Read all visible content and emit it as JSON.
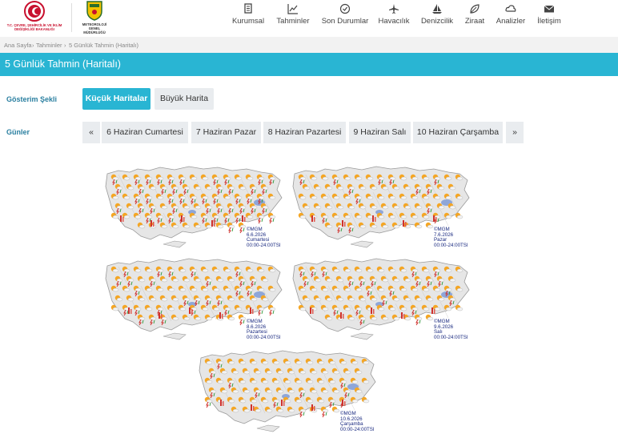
{
  "header": {
    "logo1_text": "T.C. ÇEVRE, ŞEHİRCİLİK VE İKLİM DEĞİŞİKLİĞİ BAKANLIĞI",
    "logo2_text": "METEOROLOJİ GENEL MÜDÜRLÜĞÜ",
    "nav": [
      {
        "label": "Kurumsal",
        "icon": "document-icon"
      },
      {
        "label": "Tahminler",
        "icon": "chart-icon"
      },
      {
        "label": "Son Durumlar",
        "icon": "clock-icon"
      },
      {
        "label": "Havacılık",
        "icon": "plane-icon"
      },
      {
        "label": "Denizcilik",
        "icon": "sailboat-icon"
      },
      {
        "label": "Ziraat",
        "icon": "leaf-icon"
      },
      {
        "label": "Analizler",
        "icon": "cloud-icon"
      },
      {
        "label": "İletişim",
        "icon": "envelope-icon"
      }
    ]
  },
  "breadcrumb": {
    "home": "Ana Sayfa",
    "sep1": "›",
    "parent": "Tahminler",
    "sep2": "›",
    "current": "5 Günlük Tahmin (Haritalı)"
  },
  "page_title": "5 Günlük Tahmin (Haritalı)",
  "display": {
    "label": "Gösterim Şekli",
    "small_maps": "Küçük Haritalar",
    "big_map": "Büyük Harita"
  },
  "days_row": {
    "label": "Günler",
    "prev": "«",
    "next": "»",
    "days": [
      "6 Haziran Cumartesi",
      "7 Haziran Pazar",
      "8 Haziran Pazartesi",
      "9 Haziran Salı",
      "10 Haziran Çarşamba"
    ]
  },
  "maps": [
    {
      "source": "©MGM",
      "date": "6.6.2026",
      "day": "Cumartesi",
      "hours": "00:00-24:00TSI"
    },
    {
      "source": "©MGM",
      "date": "7.6.2026",
      "day": "Pazar",
      "hours": "00:00-24:00TSI"
    },
    {
      "source": "©MGM",
      "date": "8.6.2026",
      "day": "Pazartesi",
      "hours": "00:00-24:00TSI"
    },
    {
      "source": "©MGM",
      "date": "9.6.2026",
      "day": "Salı",
      "hours": "00:00-24:00TSI"
    },
    {
      "source": "©MGM",
      "date": "10.6.2026",
      "day": "Çarşamba",
      "hours": "00:00-24:00TSI"
    }
  ],
  "colors": {
    "accent": "#29b5d3",
    "label_blue": "#2a7fa0",
    "stamp_blue": "#1a2a80",
    "sun_orange": "#f5a623",
    "storm_red": "#d0312d"
  }
}
